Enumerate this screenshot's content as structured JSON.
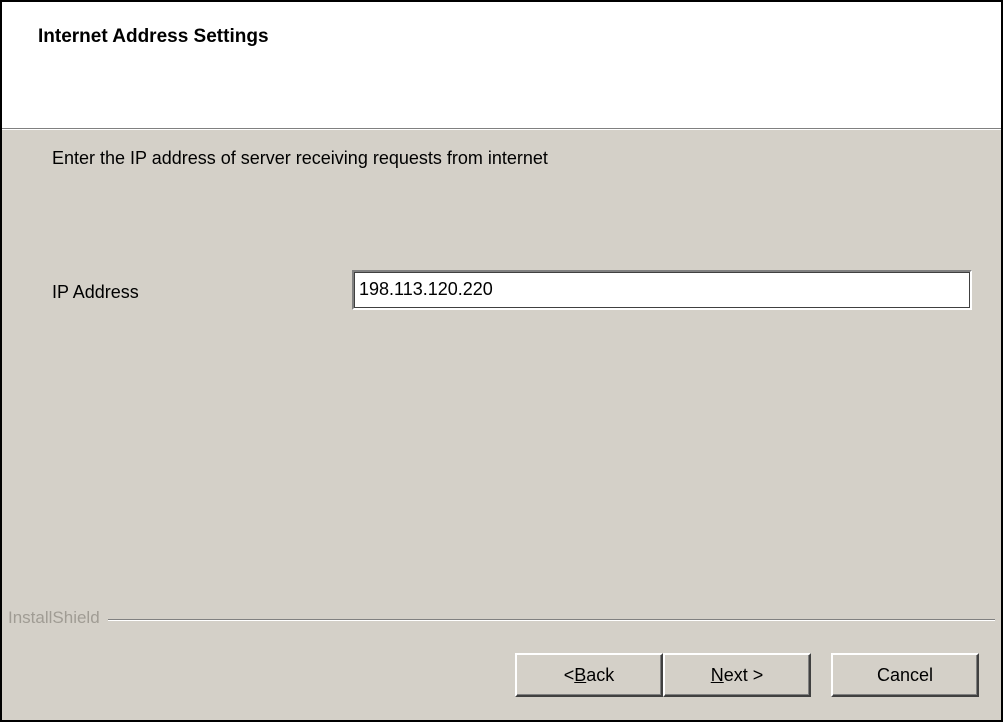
{
  "header": {
    "title": "Internet Address Settings"
  },
  "body": {
    "instruction": "Enter the IP address of server receiving requests from internet",
    "ip_label": "IP Address",
    "ip_value": "198.113.120.220"
  },
  "footer": {
    "brand": "InstallShield",
    "back_prefix": "< ",
    "back_mnemonic": "B",
    "back_rest": "ack",
    "next_mnemonic": "N",
    "next_rest": "ext >",
    "cancel_label": "Cancel"
  }
}
